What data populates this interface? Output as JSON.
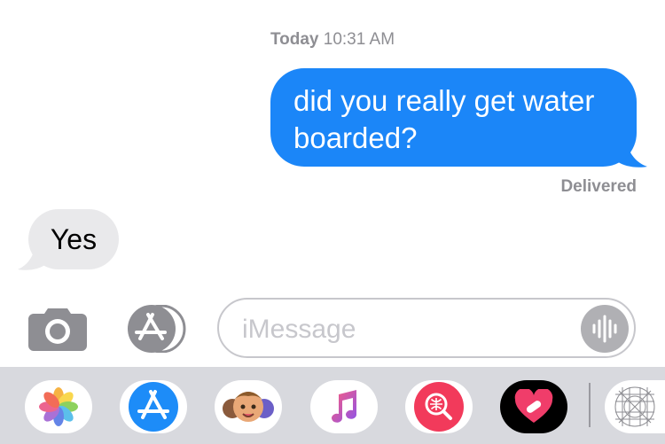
{
  "timestamp": {
    "day": "Today",
    "time": "10:31 AM"
  },
  "messages": {
    "outgoing": {
      "text_line1": "did you really get water",
      "text_line2": "boarded?",
      "status": "Delivered"
    },
    "incoming": {
      "text": "Yes"
    }
  },
  "composer": {
    "placeholder": "iMessage"
  },
  "colors": {
    "outgoing_bubble": "#1b86f8",
    "incoming_bubble": "#e9e9eb",
    "drawer": "#d8d9de"
  },
  "app_drawer": {
    "icons": [
      "photos-icon",
      "app-store-icon",
      "memoji-icon",
      "music-icon",
      "web-search-icon",
      "digital-touch-icon",
      "stickers-grid-icon"
    ]
  }
}
